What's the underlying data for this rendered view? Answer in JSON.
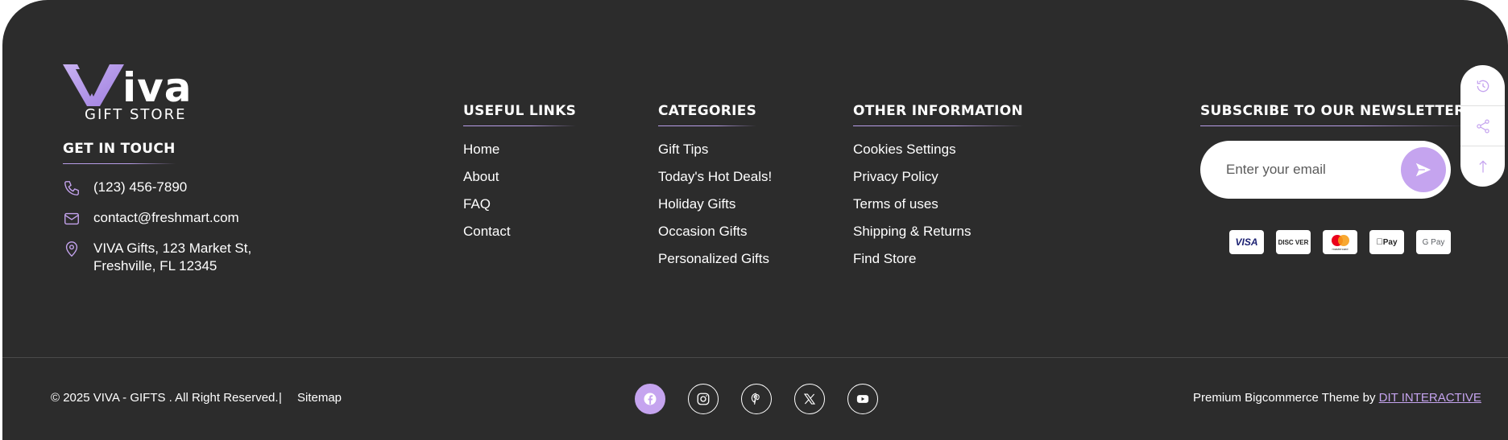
{
  "brand": {
    "word": "iva",
    "sub": "GIFT STORE",
    "accent_color": "#c5a4ef"
  },
  "contact": {
    "heading": "GET IN TOUCH",
    "phone": "(123) 456-7890",
    "email": "contact@freshmart.com",
    "address": "VIVA Gifts, 123 Market St, Freshville, FL 12345"
  },
  "useful_links": {
    "heading": "USEFUL LINKS",
    "items": [
      "Home",
      "About",
      "FAQ",
      "Contact"
    ]
  },
  "categories": {
    "heading": "CATEGORIES",
    "items": [
      "Gift Tips",
      "Today's Hot Deals!",
      "Holiday Gifts",
      "Occasion Gifts",
      "Personalized Gifts"
    ]
  },
  "other_info": {
    "heading": "OTHER INFORMATION",
    "items": [
      "Cookies Settings",
      "Privacy Policy",
      "Terms of uses",
      "Shipping & Returns",
      "Find Store"
    ]
  },
  "newsletter": {
    "heading": "SUBSCRIBE TO OUR NEWSLETTER",
    "placeholder": "Enter your email"
  },
  "payments": {
    "visa": "VISA",
    "discover": "DISC VER",
    "mastercard": "mastercard",
    "applepay": "Pay",
    "googlepay": "G Pay"
  },
  "side_rail": [
    "history-icon",
    "share-icon",
    "arrow-up-icon"
  ],
  "bottom": {
    "copyright": "© 2025 VIVA - GIFTS . All Right Reserved.",
    "separator": "|",
    "sitemap": "Sitemap",
    "credit_prefix": "Premium Bigcommerce Theme by",
    "credit_link": "DIT INTERACTIVE"
  },
  "social": [
    "facebook-icon",
    "instagram-icon",
    "pinterest-icon",
    "x-icon",
    "youtube-icon"
  ]
}
